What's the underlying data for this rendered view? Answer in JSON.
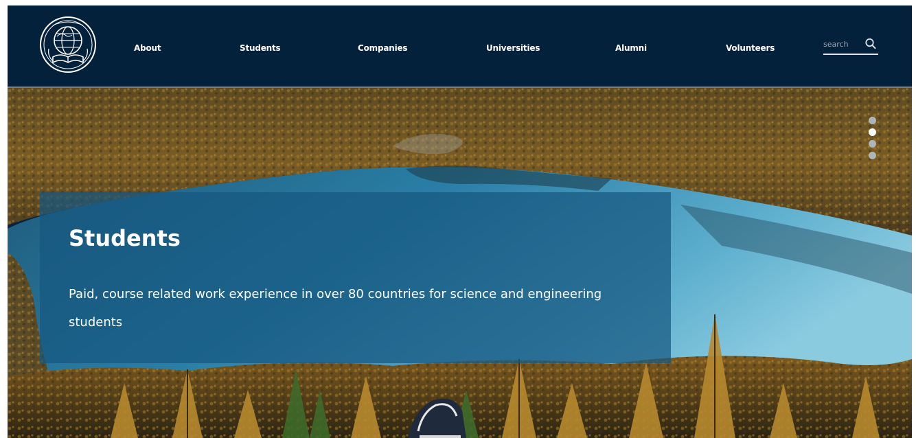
{
  "nav": {
    "logo_icon": "organization-globe-book-logo-icon",
    "items": [
      {
        "label": "About"
      },
      {
        "label": "Students"
      },
      {
        "label": "Companies"
      },
      {
        "label": "Universities"
      },
      {
        "label": "Alumni"
      },
      {
        "label": "Volunteers"
      }
    ],
    "search": {
      "placeholder": "search",
      "icon": "search-icon"
    }
  },
  "hero": {
    "title": "Students",
    "description": "Paid, course related work experience in over 80 countries for science and engineering students",
    "slider": {
      "slide_count": 4,
      "active_index": 1
    }
  },
  "colors": {
    "navbar": "#04213c",
    "caption_overlay": "#165880",
    "text": "#ffffff",
    "dot_inactive": "#aeb5b8",
    "dot_active": "#ffffff"
  }
}
